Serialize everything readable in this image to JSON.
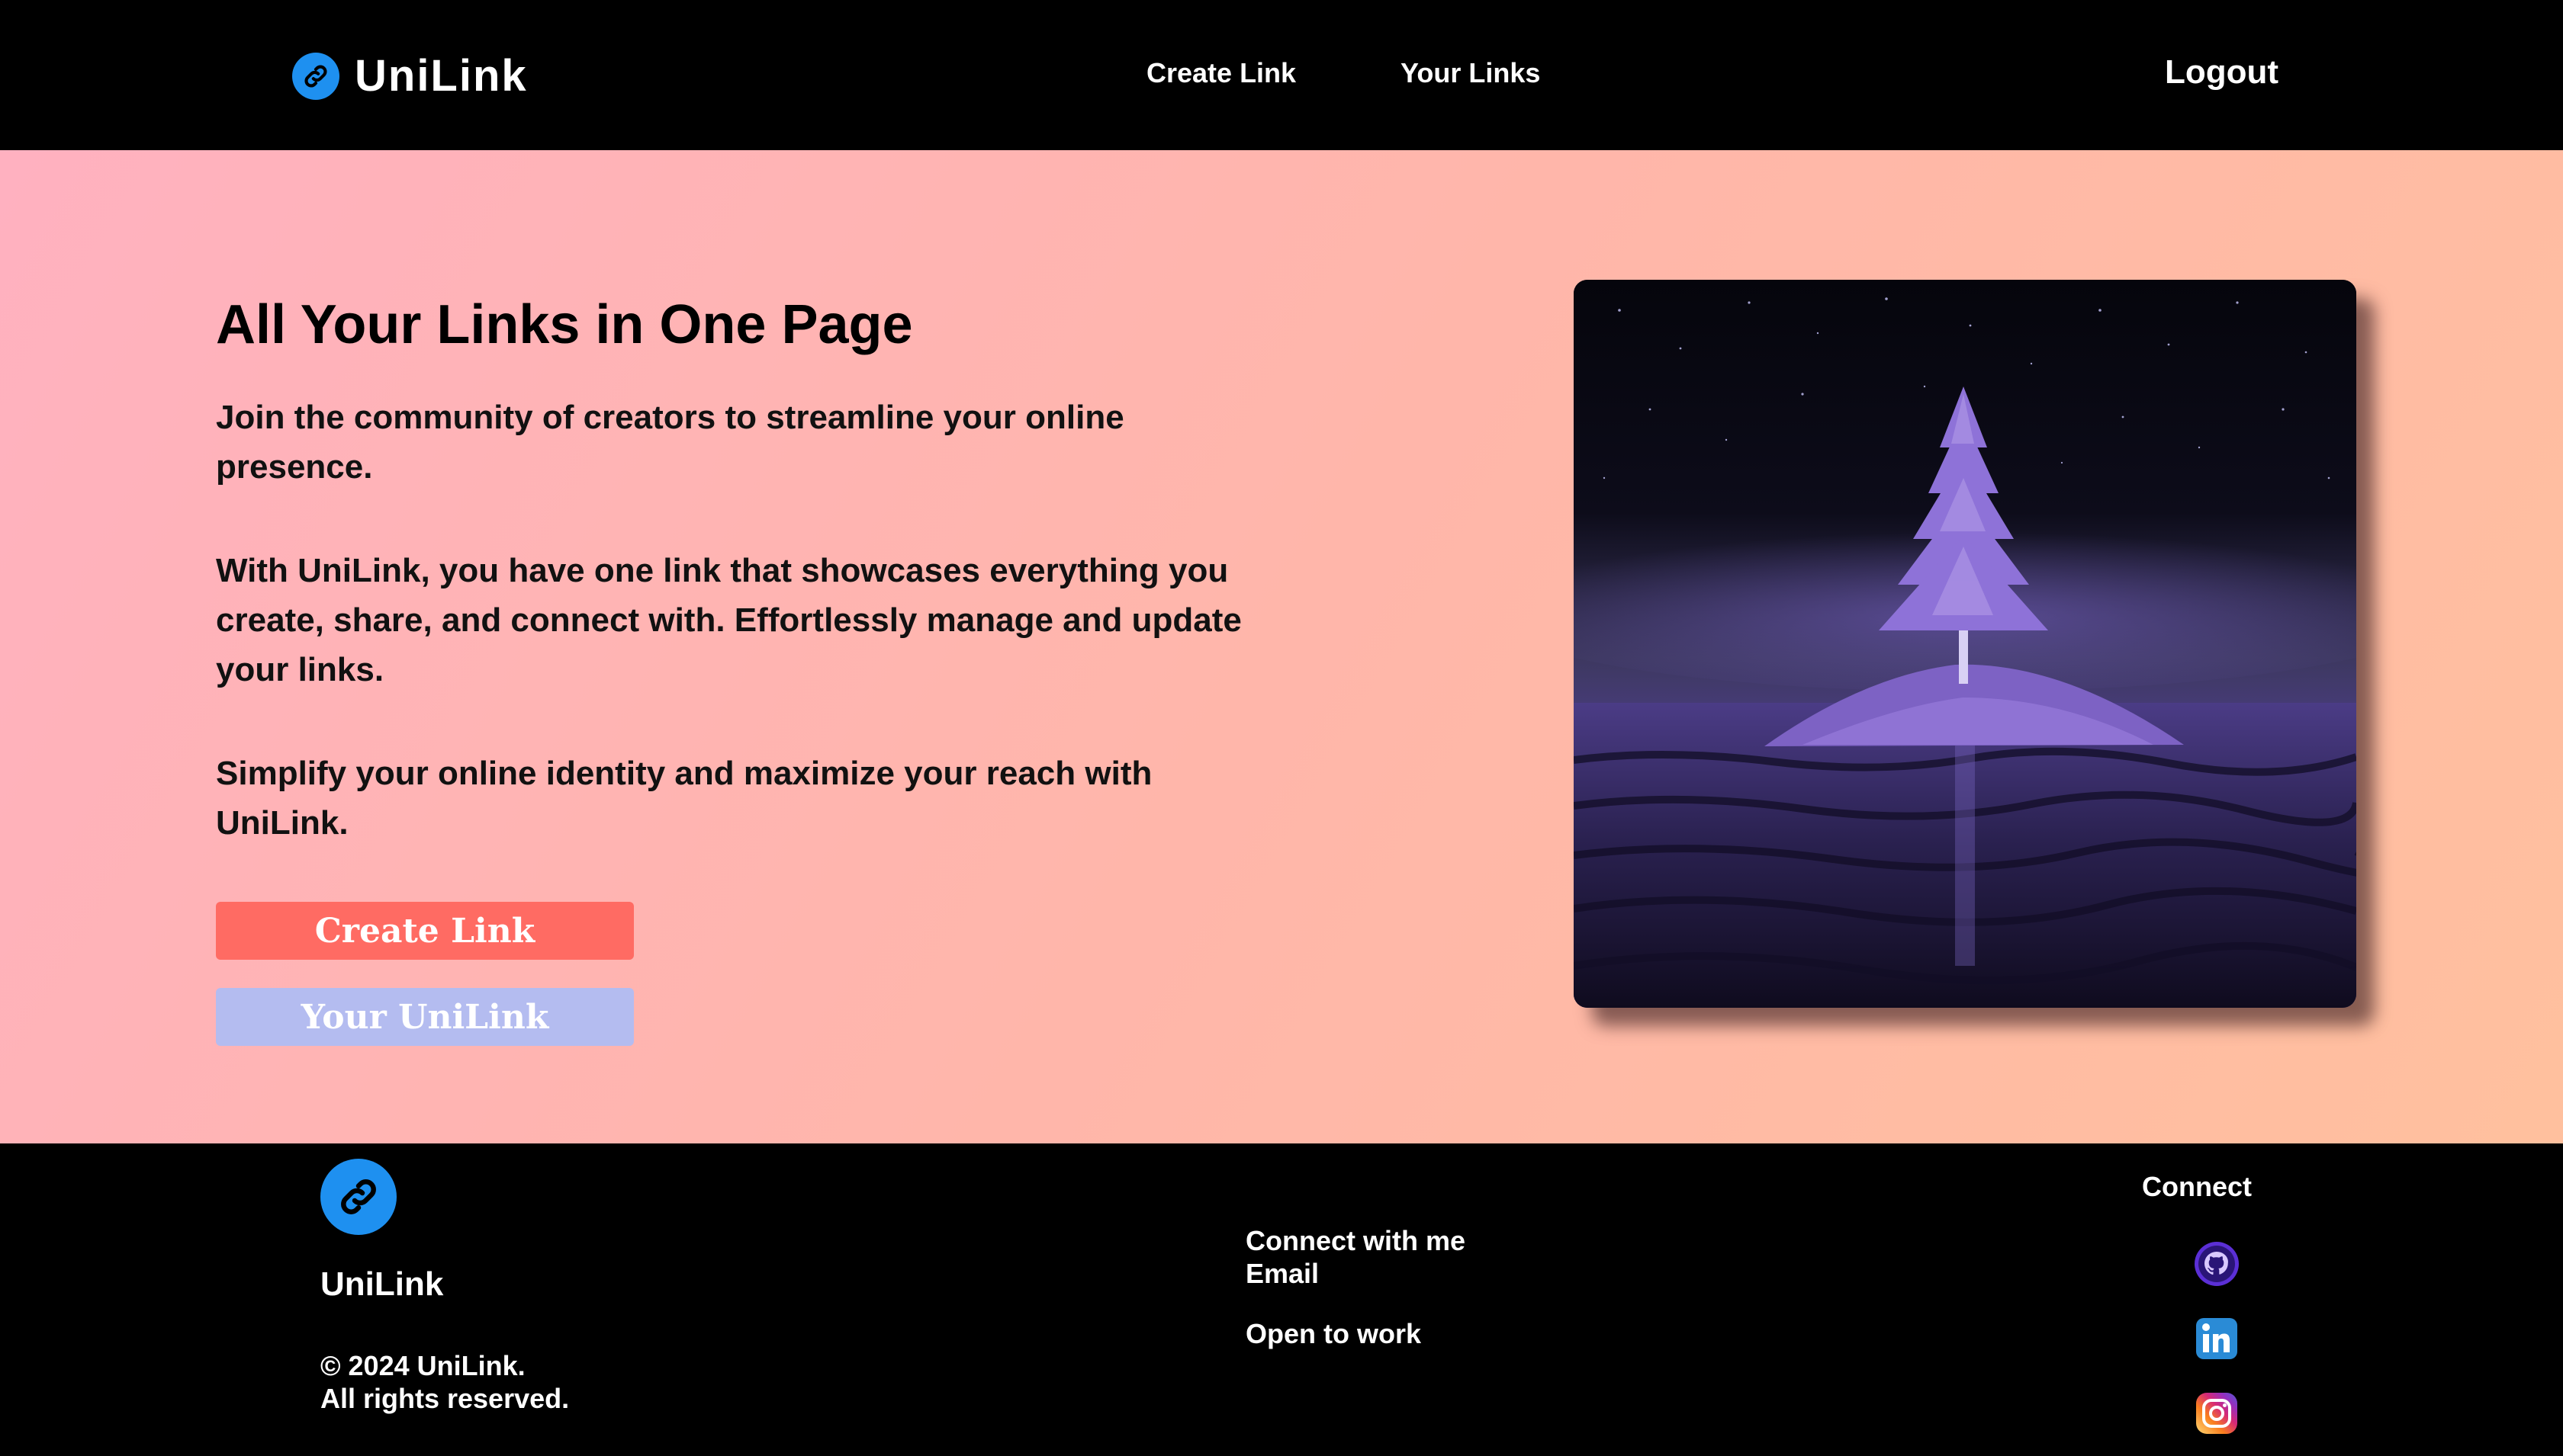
{
  "header": {
    "brand": "UniLink",
    "nav": {
      "create_link": "Create Link",
      "your_links": "Your Links"
    },
    "logout": "Logout"
  },
  "hero": {
    "title": "All Your Links in One Page",
    "paragraphs": [
      "Join the community of creators to streamline your online presence.",
      "With UniLink, you have one link that showcases everything you create, share, and connect with. Effortlessly manage and update your links.",
      "Simplify your online identity and maximize your reach with UniLink."
    ],
    "buttons": {
      "create_link": "Create Link",
      "your_unilink": "Your UniLink"
    }
  },
  "footer": {
    "brand": "UniLink",
    "copyright_line1": "© 2024 UniLink.",
    "copyright_line2": "All rights reserved.",
    "connect_with_me": "Connect with me",
    "email": "Email",
    "open_to_work": "Open to work",
    "connect_title": "Connect",
    "social_icons": [
      "github-icon",
      "linkedin-icon",
      "instagram-icon"
    ]
  },
  "colors": {
    "header_bg": "#000000",
    "accent_blue": "#1e90f0",
    "create_button": "#ff6b63",
    "unilink_button": "#b4bcf0",
    "hero_gradient_start": "#ffb1c0",
    "hero_gradient_end": "#ffc09e"
  }
}
